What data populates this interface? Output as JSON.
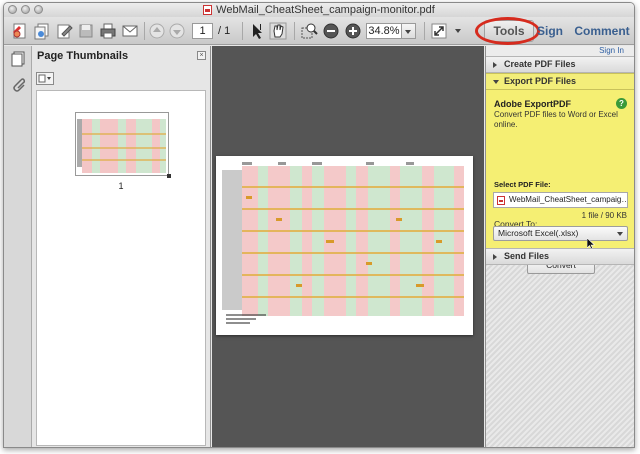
{
  "window": {
    "title": "WebMail_CheatSheet_campaign-monitor.pdf"
  },
  "toolbar": {
    "page_current": "1",
    "page_total_label": "/ 1",
    "zoom": "34.8%",
    "tabs": {
      "tools": "Tools",
      "sign": "Sign",
      "comment": "Comment"
    }
  },
  "thumbnails": {
    "header": "Page Thumbnails",
    "page_label": "1"
  },
  "tools_pane": {
    "sign_in": "Sign In",
    "sections": {
      "create": "Create PDF Files",
      "export": "Export PDF Files",
      "send": "Send Files"
    },
    "export": {
      "title": "Adobe ExportPDF",
      "description": "Convert PDF files to Word or Excel online.",
      "select_label": "Select PDF File:",
      "file_name": "WebMail_CheatSheet_campaig…",
      "file_info": "1 file / 90 KB",
      "convert_to_label": "Convert To:",
      "convert_to_value": "Microsoft Excel(.xlsx)",
      "convert_button": "Convert"
    }
  },
  "colors": {
    "accent_yellow": "#f5ef73",
    "tab_blue": "#3a5f8f",
    "highlight_ring": "#d62b1e",
    "doc_background": "#555555"
  }
}
